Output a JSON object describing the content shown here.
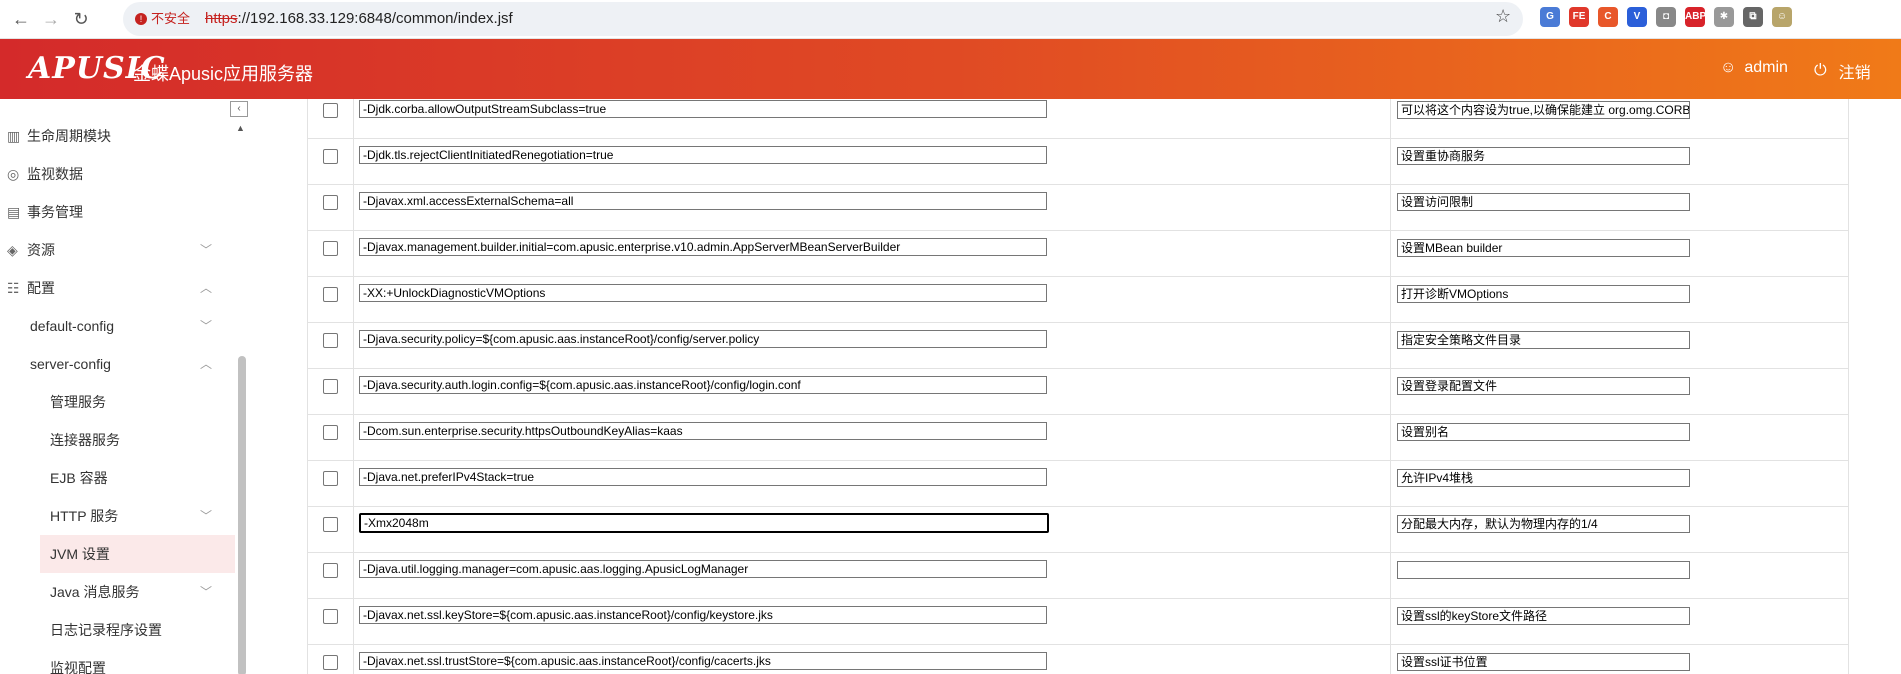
{
  "browser": {
    "back_icon": "←",
    "forward_icon": "→",
    "reload_icon": "↻",
    "insecure_label": "不安全",
    "url_scheme": "https",
    "url_rest": "://192.168.33.129:6848/common/index.jsf",
    "extensions": [
      {
        "name": "translate-ext-icon",
        "color": "#4a7bd6",
        "text": "G"
      },
      {
        "name": "fe-ext-icon",
        "color": "#e0382b",
        "text": "FE"
      },
      {
        "name": "c-ext-icon",
        "color": "#e8572a",
        "text": "C"
      },
      {
        "name": "v-ext-icon",
        "color": "#2b5fd9",
        "text": "V"
      },
      {
        "name": "camera-ext-icon",
        "color": "#888888",
        "text": "◘"
      },
      {
        "name": "abp-ext-icon",
        "color": "#d8232a",
        "text": "ABP"
      },
      {
        "name": "puzzle-ext-icon",
        "color": "#999999",
        "text": "✱"
      },
      {
        "name": "extensions-icon",
        "color": "#666666",
        "text": "⧉"
      },
      {
        "name": "profile-avatar-icon",
        "color": "#b8a56a",
        "text": "☺"
      }
    ]
  },
  "header": {
    "logo_text": "APUSIC",
    "brand": "金蝶Apusic应用服务器",
    "user": "admin",
    "logout": "注销"
  },
  "sidebar": {
    "items": [
      {
        "label": "生命周期模块",
        "icon": "▥",
        "level": 0,
        "chev": ""
      },
      {
        "label": "监视数据",
        "icon": "◎",
        "level": 0,
        "chev": ""
      },
      {
        "label": "事务管理",
        "icon": "▤",
        "level": 0,
        "chev": ""
      },
      {
        "label": "资源",
        "icon": "◈",
        "level": 0,
        "chev": "﹀"
      },
      {
        "label": "配置",
        "icon": "☷",
        "level": 0,
        "chev": "︿"
      },
      {
        "label": "default-config",
        "icon": "",
        "level": 1,
        "chev": "﹀"
      },
      {
        "label": "server-config",
        "icon": "",
        "level": 1,
        "chev": "︿"
      },
      {
        "label": "管理服务",
        "icon": "",
        "level": 2,
        "chev": ""
      },
      {
        "label": "连接器服务",
        "icon": "",
        "level": 2,
        "chev": ""
      },
      {
        "label": "EJB 容器",
        "icon": "",
        "level": 2,
        "chev": ""
      },
      {
        "label": "HTTP 服务",
        "icon": "",
        "level": 2,
        "chev": "﹀"
      },
      {
        "label": "JVM 设置",
        "icon": "",
        "level": 2,
        "chev": "",
        "active": true
      },
      {
        "label": "Java 消息服务",
        "icon": "",
        "level": 2,
        "chev": "﹀"
      },
      {
        "label": "日志记录程序设置",
        "icon": "",
        "level": 2,
        "chev": ""
      },
      {
        "label": "监视配置",
        "icon": "",
        "level": 2,
        "chev": ""
      }
    ]
  },
  "jvm_options": [
    {
      "option": "-Djdk.corba.allowOutputStreamSubclass=true",
      "description": "可以将这个内容设为true,以确保能建立 org.omg.CORBA"
    },
    {
      "option": "-Djdk.tls.rejectClientInitiatedRenegotiation=true",
      "description": "设置重协商服务"
    },
    {
      "option": "-Djavax.xml.accessExternalSchema=all",
      "description": "设置访问限制"
    },
    {
      "option": "-Djavax.management.builder.initial=com.apusic.enterprise.v10.admin.AppServerMBeanServerBuilder",
      "description": "设置MBean builder"
    },
    {
      "option": "-XX:+UnlockDiagnosticVMOptions",
      "description": "打开诊断VMOptions"
    },
    {
      "option": "-Djava.security.policy=${com.apusic.aas.instanceRoot}/config/server.policy",
      "description": "指定安全策略文件目录"
    },
    {
      "option": "-Djava.security.auth.login.config=${com.apusic.aas.instanceRoot}/config/login.conf",
      "description": "设置登录配置文件"
    },
    {
      "option": "-Dcom.sun.enterprise.security.httpsOutboundKeyAlias=kaas",
      "description": "设置别名"
    },
    {
      "option": "-Djava.net.preferIPv4Stack=true",
      "description": "允许IPv4堆栈"
    },
    {
      "option": "-Xmx2048m",
      "description": "分配最大内存，默认为物理内存的1/4",
      "focused": true
    },
    {
      "option": "-Djava.util.logging.manager=com.apusic.aas.logging.ApusicLogManager",
      "description": ""
    },
    {
      "option": "-Djavax.net.ssl.keyStore=${com.apusic.aas.instanceRoot}/config/keystore.jks",
      "description": "设置ssl的keyStore文件路径"
    },
    {
      "option": "-Djavax.net.ssl.trustStore=${com.apusic.aas.instanceRoot}/config/cacerts.jks",
      "description": "设置ssl证书位置"
    }
  ]
}
